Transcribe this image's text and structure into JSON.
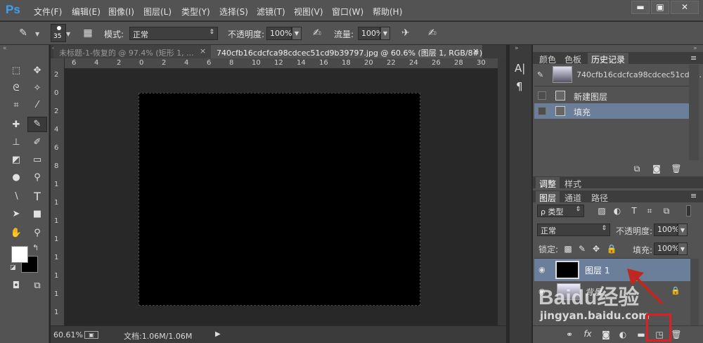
{
  "app": {
    "logo": "Ps"
  },
  "menu": [
    "文件(F)",
    "编辑(E)",
    "图像(I)",
    "图层(L)",
    "类型(Y)",
    "选择(S)",
    "滤镜(T)",
    "视图(V)",
    "窗口(W)",
    "帮助(H)"
  ],
  "window_controls": {
    "minimize": "▬",
    "maximize": "▣",
    "close": "✕"
  },
  "options": {
    "brush_size": "35",
    "mode_label": "模式:",
    "mode_value": "正常",
    "opacity_label": "不透明度:",
    "opacity_value": "100%",
    "flow_label": "流量:",
    "flow_value": "100%"
  },
  "doc_tabs": [
    {
      "label": "未标题-1-恢复的 @ 97.4% (矩形 1, ...",
      "close": "×"
    },
    {
      "label": "740cfb16cdcfca98cdcec51cd9b39797.jpg @ 60.6% (图层 1, RGB/8#) *",
      "close": "×"
    }
  ],
  "ruler": {
    "h_ticks": [
      "6",
      "4",
      "2",
      "0",
      "2",
      "4",
      "6",
      "8",
      "10",
      "12",
      "14",
      "16",
      "18",
      "20",
      "22",
      "24",
      "26",
      "28",
      "30"
    ],
    "v_ticks": [
      "2",
      "0",
      "2",
      "4",
      "6",
      "8",
      "1",
      "1",
      "1",
      "1",
      "1",
      "1",
      "1",
      "1"
    ]
  },
  "status": {
    "zoom": "60.61%",
    "doc_info": "文档:1.06M/1.06M"
  },
  "history_panel": {
    "tabs": [
      "颜色",
      "色板",
      "历史记录"
    ],
    "snapshot_name": "740cfb16cdcfca98cdcec51cd9...",
    "items": [
      "新建图层",
      "填充"
    ]
  },
  "adjust_panel": {
    "tabs": [
      "调整",
      "样式"
    ]
  },
  "layers_panel": {
    "tabs": [
      "图层",
      "通道",
      "路径"
    ],
    "filter_label": "ρ 类型",
    "blend_mode": "正常",
    "opacity_label": "不透明度:",
    "opacity_value": "100%",
    "lock_label": "锁定:",
    "fill_label": "填充:",
    "fill_value": "100%",
    "layers": [
      {
        "name": "图层 1",
        "selected": true
      },
      {
        "name": "背景",
        "selected": false
      }
    ]
  },
  "watermark": {
    "brand": "Baidu经验",
    "url": "jingyan.baidu.com"
  },
  "colors": {
    "accent_selected": "#6b7f9a",
    "highlight_box": "#e02020",
    "arrow": "#c0271f",
    "ps_blue": "#3ea0f2"
  },
  "icons": [
    "brush-icon",
    "move-icon",
    "marquee-icon",
    "lasso-icon",
    "magic-wand-icon",
    "crop-icon",
    "eyedropper-icon",
    "healing-icon",
    "stamp-icon",
    "history-brush-icon",
    "eraser-icon",
    "gradient-icon",
    "blur-icon",
    "dodge-icon",
    "pen-icon",
    "type-icon",
    "path-select-icon",
    "rectangle-icon",
    "hand-icon",
    "zoom-icon",
    "eye-icon",
    "lock-icon",
    "link-icon",
    "fx-icon",
    "mask-icon",
    "adjustment-icon",
    "folder-icon",
    "new-layer-icon",
    "trash-icon"
  ]
}
